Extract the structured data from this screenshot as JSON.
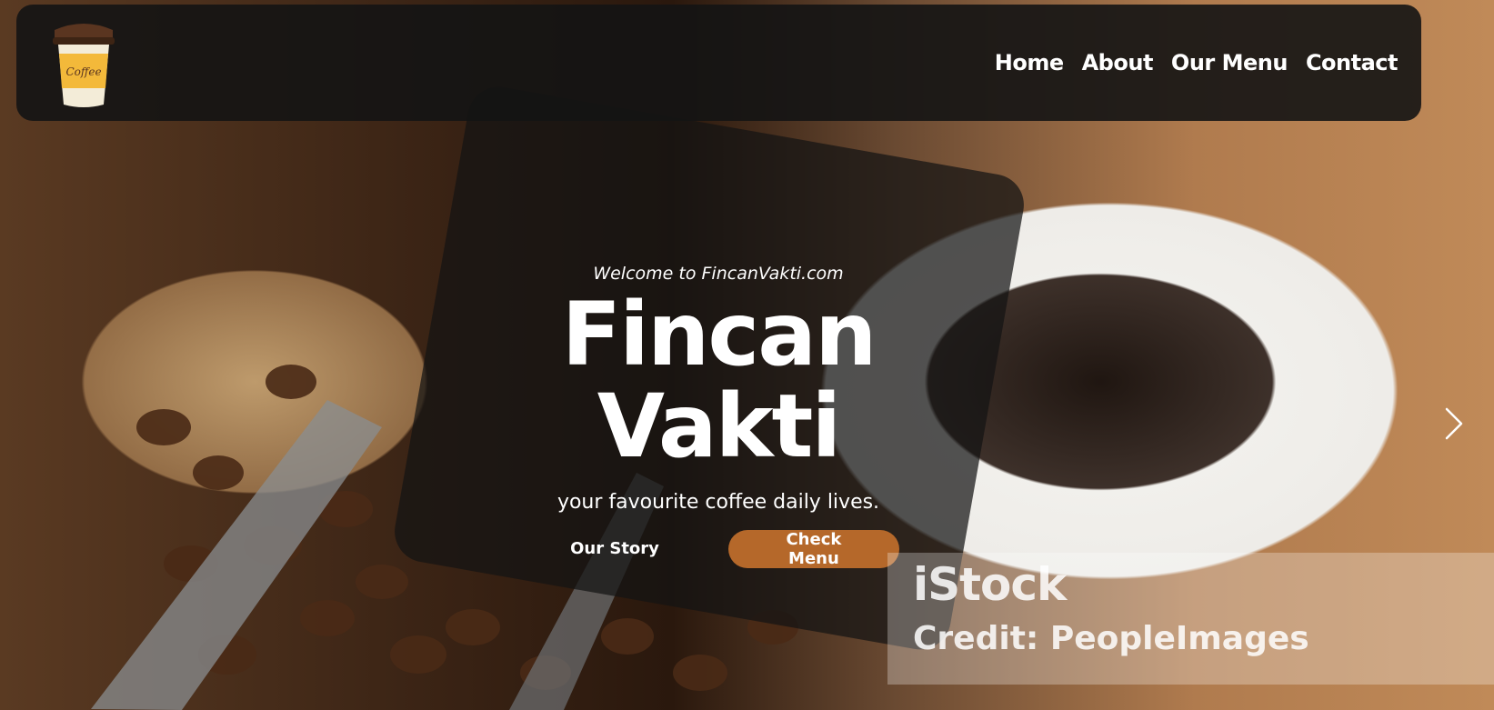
{
  "nav": {
    "logo_text": "Coffee",
    "links": [
      {
        "label": "Home"
      },
      {
        "label": "About"
      },
      {
        "label": "Our Menu"
      },
      {
        "label": "Contact"
      }
    ]
  },
  "hero": {
    "welcome": "Welcome to FincanVakti.com",
    "title": "Fincan Vakti",
    "tagline": "your favourite coffee daily lives.",
    "buttons": {
      "secondary_label": "Our Story",
      "primary_label": "Check Menu"
    }
  },
  "watermark": {
    "brand": "iStock",
    "credit": "Credit: PeopleImages"
  },
  "colors": {
    "accent": "#b5682a",
    "navbar_bg": "#141414"
  },
  "icons": {
    "logo": "coffee-cup-icon",
    "next": "chevron-right-icon"
  }
}
